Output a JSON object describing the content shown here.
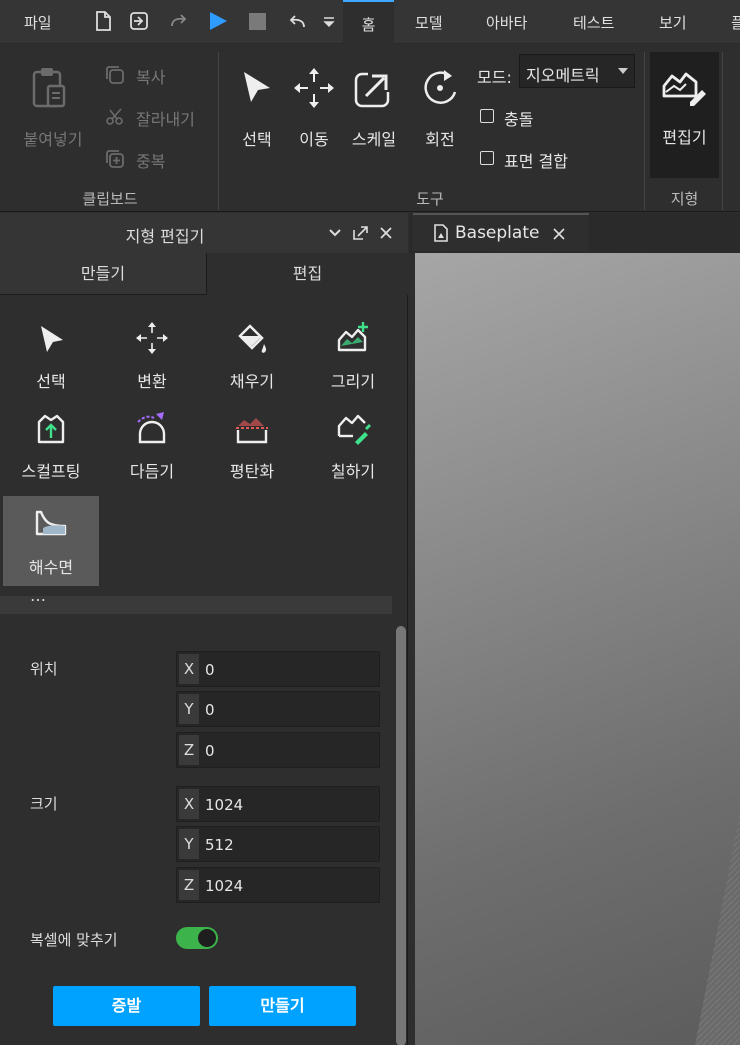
{
  "menu": {
    "file": "파일",
    "tabs": [
      "홈",
      "모델",
      "아바타",
      "테스트",
      "보기",
      "플"
    ]
  },
  "ribbon": {
    "clipboard": {
      "paste": "붙여넣기",
      "copy": "복사",
      "cut": "잘라내기",
      "duplicate": "중복",
      "group_label": "클립보드"
    },
    "tools": {
      "select": "선택",
      "move": "이동",
      "scale": "스케일",
      "rotate": "회전",
      "mode_label": "모드:",
      "mode_value": "지오메트릭",
      "collisions": "충돌",
      "join_surfaces": "표면 결합",
      "group_label": "도구"
    },
    "terrain": {
      "editor": "편집기",
      "group_label": "지형"
    }
  },
  "panel": {
    "title": "지형 편집기",
    "tabs": [
      "만들기",
      "편집"
    ],
    "tools": [
      "선택",
      "변환",
      "채우기",
      "그리기",
      "스컬프팅",
      "다듬기",
      "평탄화",
      "칠하기",
      "해수면"
    ],
    "section_header": "…",
    "position_label": "위치",
    "position": {
      "x": "0",
      "y": "0",
      "z": "0"
    },
    "size_label": "크기",
    "size": {
      "x": "1024",
      "y": "512",
      "z": "1024"
    },
    "snap_label": "복셀에 맞추기",
    "snap_enabled": true,
    "evaporate_button": "증발",
    "create_button": "만들기"
  },
  "document": {
    "tab_title": "Baseplate"
  },
  "colors": {
    "accent": "#00a2ff",
    "toggle_on": "#3cb44b"
  }
}
